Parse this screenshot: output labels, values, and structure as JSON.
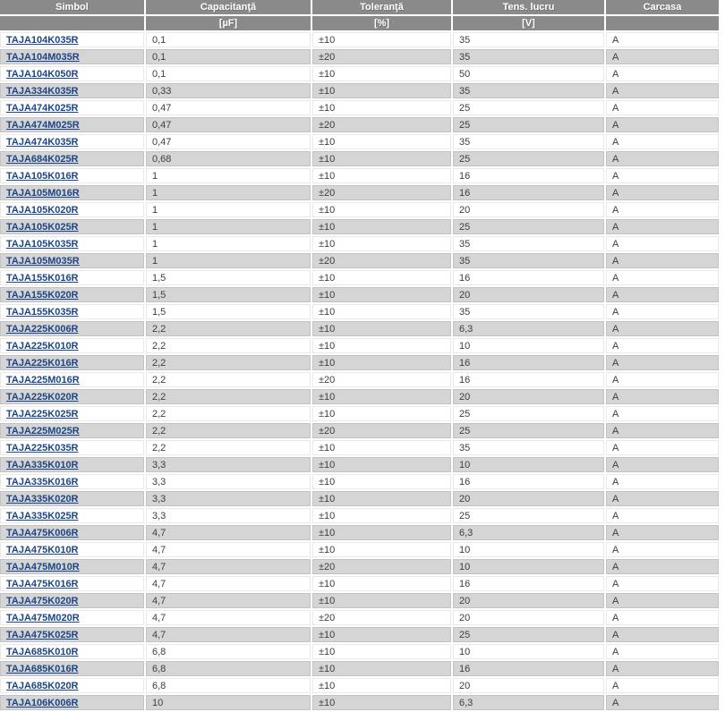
{
  "colors": {
    "header_bg": "#8a8a8a",
    "header_text": "#ffffff",
    "row_alt_bg": "#d5d5d5",
    "row_bg": "#ffffff",
    "link_color": "#1c4587",
    "cell_text": "#3d3d3d"
  },
  "table": {
    "columns": [
      {
        "label": "Simbol",
        "unit": ""
      },
      {
        "label": "Capacitanţă",
        "unit": "[µF]"
      },
      {
        "label": "Toleranţă",
        "unit": "[%]"
      },
      {
        "label": "Tens. lucru",
        "unit": "[V]"
      },
      {
        "label": "Carcasa",
        "unit": ""
      }
    ],
    "rows": [
      {
        "symbol": "TAJA104K035R",
        "capacitance": "0,1",
        "tolerance": "±10",
        "voltage": "35",
        "case": "A"
      },
      {
        "symbol": "TAJA104M035R",
        "capacitance": "0,1",
        "tolerance": "±20",
        "voltage": "35",
        "case": "A"
      },
      {
        "symbol": "TAJA104K050R",
        "capacitance": "0,1",
        "tolerance": "±10",
        "voltage": "50",
        "case": "A"
      },
      {
        "symbol": "TAJA334K035R",
        "capacitance": "0,33",
        "tolerance": "±10",
        "voltage": "35",
        "case": "A"
      },
      {
        "symbol": "TAJA474K025R",
        "capacitance": "0,47",
        "tolerance": "±10",
        "voltage": "25",
        "case": "A"
      },
      {
        "symbol": "TAJA474M025R",
        "capacitance": "0,47",
        "tolerance": "±20",
        "voltage": "25",
        "case": "A"
      },
      {
        "symbol": "TAJA474K035R",
        "capacitance": "0,47",
        "tolerance": "±10",
        "voltage": "35",
        "case": "A"
      },
      {
        "symbol": "TAJA684K025R",
        "capacitance": "0,68",
        "tolerance": "±10",
        "voltage": "25",
        "case": "A"
      },
      {
        "symbol": "TAJA105K016R",
        "capacitance": "1",
        "tolerance": "±10",
        "voltage": "16",
        "case": "A"
      },
      {
        "symbol": "TAJA105M016R",
        "capacitance": "1",
        "tolerance": "±20",
        "voltage": "16",
        "case": "A"
      },
      {
        "symbol": "TAJA105K020R",
        "capacitance": "1",
        "tolerance": "±10",
        "voltage": "20",
        "case": "A"
      },
      {
        "symbol": "TAJA105K025R",
        "capacitance": "1",
        "tolerance": "±10",
        "voltage": "25",
        "case": "A"
      },
      {
        "symbol": "TAJA105K035R",
        "capacitance": "1",
        "tolerance": "±10",
        "voltage": "35",
        "case": "A"
      },
      {
        "symbol": "TAJA105M035R",
        "capacitance": "1",
        "tolerance": "±20",
        "voltage": "35",
        "case": "A"
      },
      {
        "symbol": "TAJA155K016R",
        "capacitance": "1,5",
        "tolerance": "±10",
        "voltage": "16",
        "case": "A"
      },
      {
        "symbol": "TAJA155K020R",
        "capacitance": "1,5",
        "tolerance": "±10",
        "voltage": "20",
        "case": "A"
      },
      {
        "symbol": "TAJA155K035R",
        "capacitance": "1,5",
        "tolerance": "±10",
        "voltage": "35",
        "case": "A"
      },
      {
        "symbol": "TAJA225K006R",
        "capacitance": "2,2",
        "tolerance": "±10",
        "voltage": "6,3",
        "case": "A"
      },
      {
        "symbol": "TAJA225K010R",
        "capacitance": "2,2",
        "tolerance": "±10",
        "voltage": "10",
        "case": "A"
      },
      {
        "symbol": "TAJA225K016R",
        "capacitance": "2,2",
        "tolerance": "±10",
        "voltage": "16",
        "case": "A"
      },
      {
        "symbol": "TAJA225M016R",
        "capacitance": "2,2",
        "tolerance": "±20",
        "voltage": "16",
        "case": "A"
      },
      {
        "symbol": "TAJA225K020R",
        "capacitance": "2,2",
        "tolerance": "±10",
        "voltage": "20",
        "case": "A"
      },
      {
        "symbol": "TAJA225K025R",
        "capacitance": "2,2",
        "tolerance": "±10",
        "voltage": "25",
        "case": "A"
      },
      {
        "symbol": "TAJA225M025R",
        "capacitance": "2,2",
        "tolerance": "±20",
        "voltage": "25",
        "case": "A"
      },
      {
        "symbol": "TAJA225K035R",
        "capacitance": "2,2",
        "tolerance": "±10",
        "voltage": "35",
        "case": "A"
      },
      {
        "symbol": "TAJA335K010R",
        "capacitance": "3,3",
        "tolerance": "±10",
        "voltage": "10",
        "case": "A"
      },
      {
        "symbol": "TAJA335K016R",
        "capacitance": "3,3",
        "tolerance": "±10",
        "voltage": "16",
        "case": "A"
      },
      {
        "symbol": "TAJA335K020R",
        "capacitance": "3,3",
        "tolerance": "±10",
        "voltage": "20",
        "case": "A"
      },
      {
        "symbol": "TAJA335K025R",
        "capacitance": "3,3",
        "tolerance": "±10",
        "voltage": "25",
        "case": "A"
      },
      {
        "symbol": "TAJA475K006R",
        "capacitance": "4,7",
        "tolerance": "±10",
        "voltage": "6,3",
        "case": "A"
      },
      {
        "symbol": "TAJA475K010R",
        "capacitance": "4,7",
        "tolerance": "±10",
        "voltage": "10",
        "case": "A"
      },
      {
        "symbol": "TAJA475M010R",
        "capacitance": "4,7",
        "tolerance": "±20",
        "voltage": "10",
        "case": "A"
      },
      {
        "symbol": "TAJA475K016R",
        "capacitance": "4,7",
        "tolerance": "±10",
        "voltage": "16",
        "case": "A"
      },
      {
        "symbol": "TAJA475K020R",
        "capacitance": "4,7",
        "tolerance": "±10",
        "voltage": "20",
        "case": "A"
      },
      {
        "symbol": "TAJA475M020R",
        "capacitance": "4,7",
        "tolerance": "±20",
        "voltage": "20",
        "case": "A"
      },
      {
        "symbol": "TAJA475K025R",
        "capacitance": "4,7",
        "tolerance": "±10",
        "voltage": "25",
        "case": "A"
      },
      {
        "symbol": "TAJA685K010R",
        "capacitance": "6,8",
        "tolerance": "±10",
        "voltage": "10",
        "case": "A"
      },
      {
        "symbol": "TAJA685K016R",
        "capacitance": "6,8",
        "tolerance": "±10",
        "voltage": "16",
        "case": "A"
      },
      {
        "symbol": "TAJA685K020R",
        "capacitance": "6,8",
        "tolerance": "±10",
        "voltage": "20",
        "case": "A"
      },
      {
        "symbol": "TAJA106K006R",
        "capacitance": "10",
        "tolerance": "±10",
        "voltage": "6,3",
        "case": "A"
      }
    ]
  }
}
